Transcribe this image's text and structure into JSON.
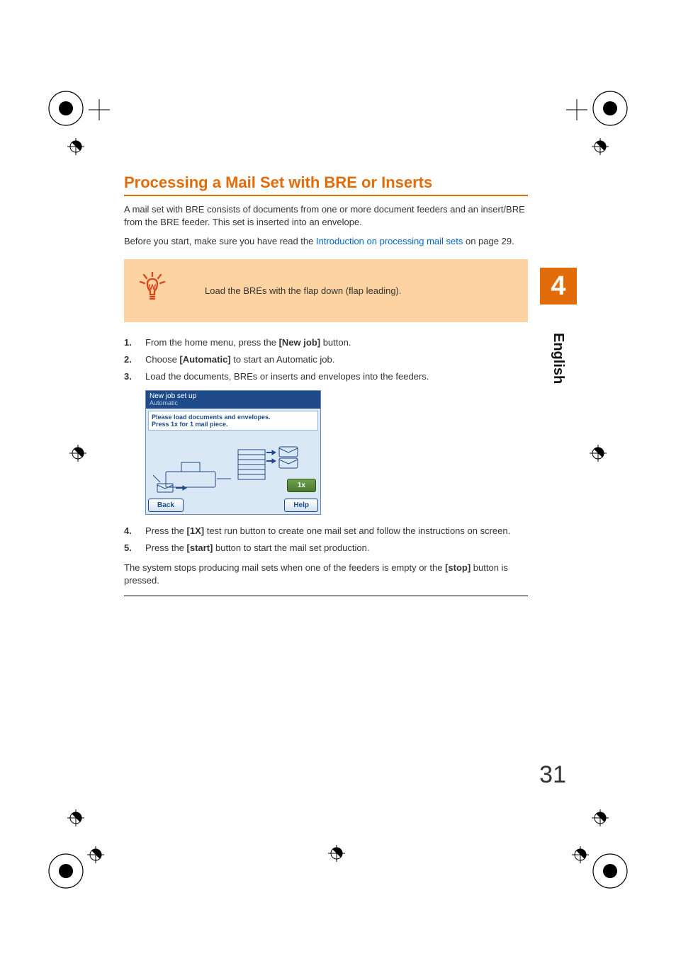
{
  "heading": "Processing a Mail Set with BRE or Inserts",
  "intro_1": "A mail set with BRE consists of documents from one or more document feeders and an insert/BRE from the BRE feeder. This set is inserted into an envelope.",
  "intro_2a": "Before you start, make sure you have read the ",
  "intro_2_link": "Introduction on processing mail sets",
  "intro_2b": " on page 29.",
  "tip_text": "Load the BREs with the flap down (flap leading).",
  "steps": [
    {
      "num": "1.",
      "pre": "From the home menu, press the ",
      "bold": "[New job]",
      "post": " button."
    },
    {
      "num": "2.",
      "pre": "Choose ",
      "bold": "[Automatic]",
      "post": " to start an Automatic job."
    },
    {
      "num": "3.",
      "pre": "Load the documents, BREs or inserts and envelopes into the feeders.",
      "bold": "",
      "post": ""
    },
    {
      "num": "4.",
      "pre": "Press the ",
      "bold": "[1X]",
      "post": " test run button to create one mail set and follow the instructions on screen."
    },
    {
      "num": "5.",
      "pre": "Press the ",
      "bold": "[start]",
      "post": " button to start the mail set production."
    }
  ],
  "footer_a": "The system stops producing mail sets when one of the feeders is empty or the ",
  "footer_bold": "[stop]",
  "footer_b": " button is pressed.",
  "screenshot": {
    "title": "New job set up",
    "subtitle": "Automatic",
    "msg_line1": "Please load documents and envelopes.",
    "msg_line2": "Press 1x for 1 mail piece.",
    "btn_back": "Back",
    "btn_help": "Help",
    "btn_1x": "1x"
  },
  "side_tab": "4",
  "side_lang": "English",
  "page_num": "31"
}
